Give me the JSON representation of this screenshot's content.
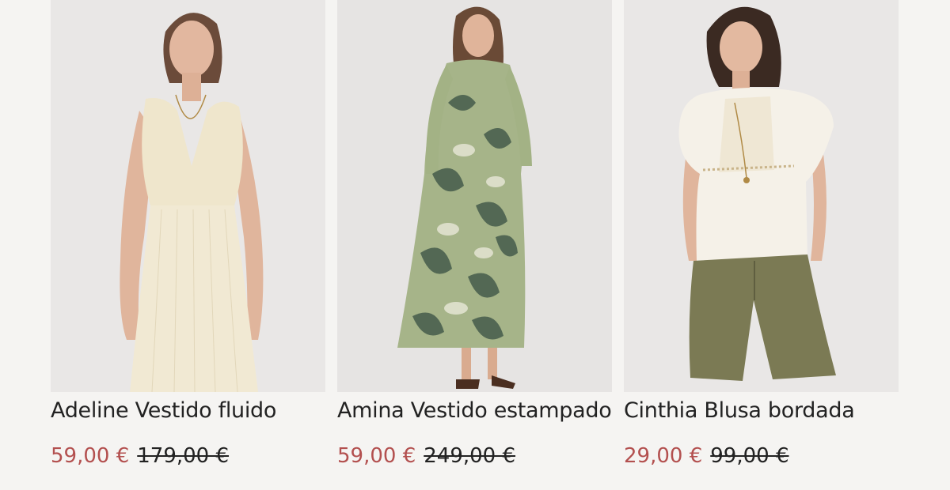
{
  "products": [
    {
      "name": "Adeline Vestido fluido",
      "sale_price": "59,00 €",
      "original_price": "179,00 €",
      "image": "model in cream sleeveless v-neck flowing dress"
    },
    {
      "name": "Amina Vestido estampado",
      "sale_price": "59,00 €",
      "original_price": "249,00 €",
      "image": "model in green ikat print long dress with sandals"
    },
    {
      "name": "Cinthia Blusa bordada",
      "sale_price": "29,00 €",
      "original_price": "99,00 €",
      "image": "model in white embroidered ruffle blouse and olive shorts"
    }
  ],
  "colors": {
    "sale": "#b3504f",
    "text": "#222222",
    "page_background": "#f5f4f2"
  }
}
